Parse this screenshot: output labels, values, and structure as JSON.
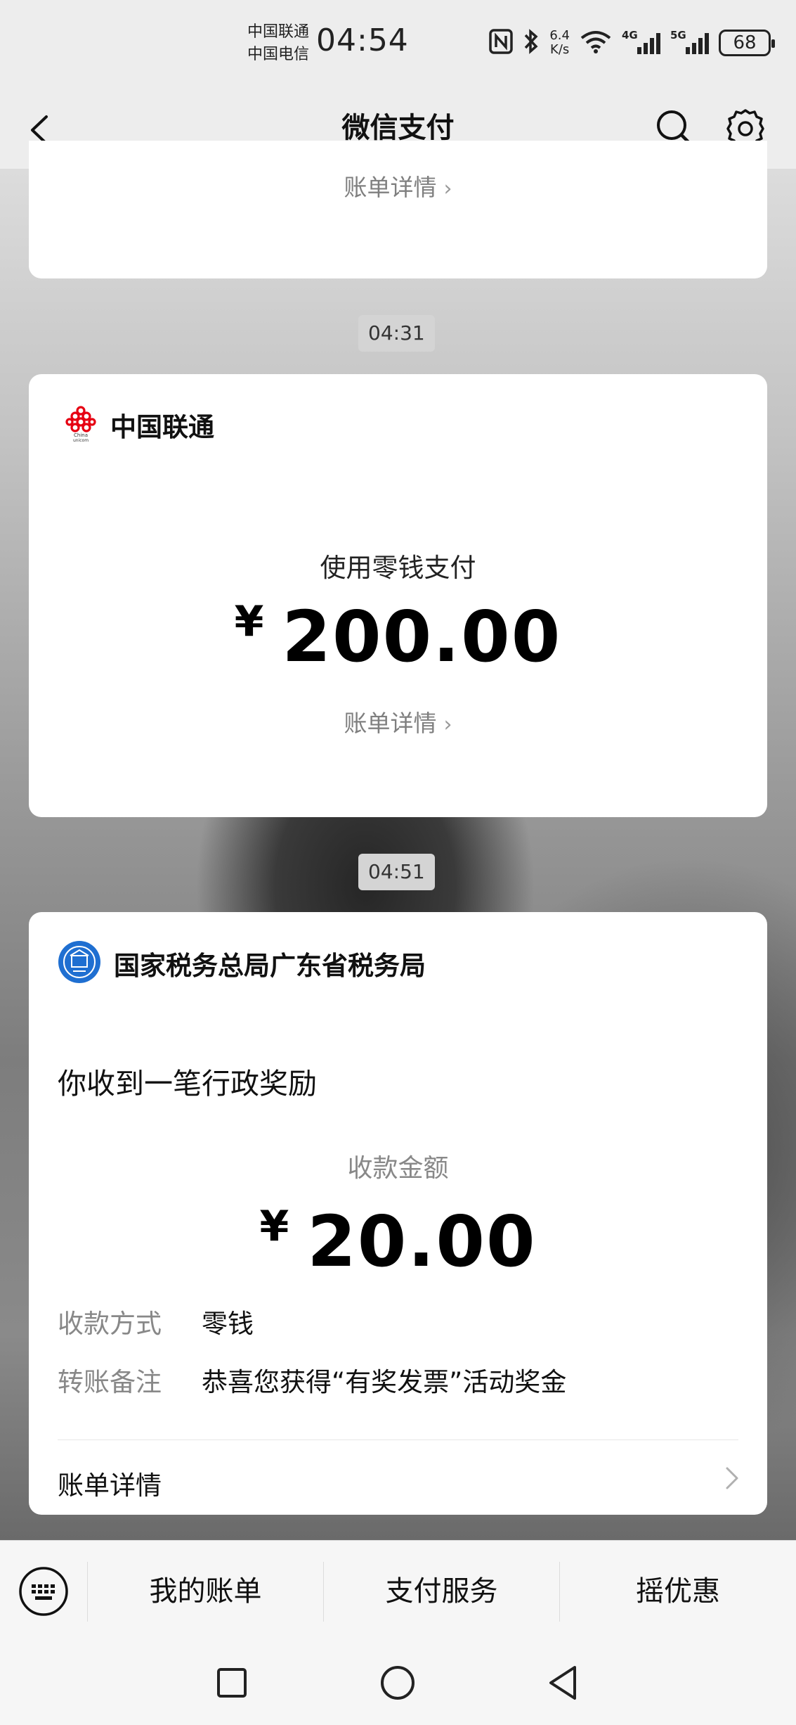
{
  "status_bar": {
    "carrier_1": "中国联通",
    "carrier_2": "中国电信",
    "time": "04:54",
    "net_speed_value": "6.4",
    "net_speed_unit": "K/s",
    "signal_1_tag": "4G",
    "signal_2_tag": "5G",
    "battery": "68",
    "icons": [
      "nfc-icon",
      "bluetooth-icon",
      "wifi-icon",
      "signal-icon",
      "battery-icon"
    ]
  },
  "nav": {
    "title": "微信支付",
    "icons": [
      "back-icon",
      "search-icon",
      "settings-icon"
    ]
  },
  "messages": [
    {
      "detail_link": "账单详情"
    },
    {
      "time": "04:31",
      "merchant": "中国联通",
      "logo_text": "China unicom",
      "method": "使用零钱支付",
      "currency": "¥",
      "amount": "200.00",
      "detail_link": "账单详情"
    },
    {
      "time": "04:51",
      "merchant": "国家税务总局广东省税务局",
      "headline": "你收到一笔行政奖励",
      "amount_label": "收款金额",
      "currency": "¥",
      "amount": "20.00",
      "fields": [
        {
          "label": "收款方式",
          "value": "零钱"
        },
        {
          "label": "转账备注",
          "value": "恭喜您获得“有奖发票”活动奖金"
        }
      ],
      "detail_link": "账单详情"
    }
  ],
  "bottom_menu": {
    "items": [
      "我的账单",
      "支付服务",
      "摇优惠"
    ],
    "keyboard_icon": "keyboard-icon"
  },
  "system_nav": [
    "recent-apps-icon",
    "home-icon",
    "back-triangle-icon"
  ]
}
